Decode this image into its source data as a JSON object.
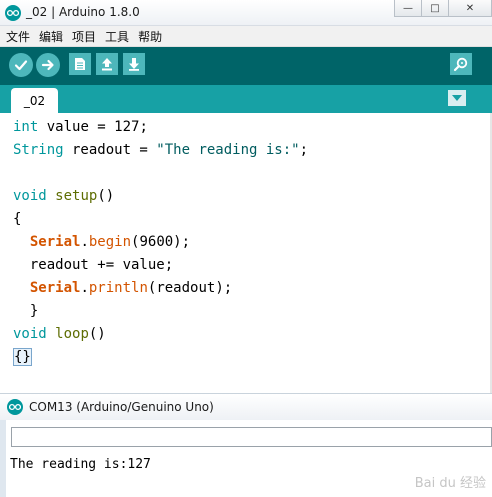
{
  "window": {
    "title": "_02 | Arduino 1.8.0",
    "controls": {
      "minimize": "—",
      "maximize": "□",
      "close": "✕"
    }
  },
  "menu": {
    "items": [
      "文件",
      "编辑",
      "项目",
      "工具",
      "帮助"
    ]
  },
  "toolbar": {
    "buttons": [
      "verify-icon",
      "upload-icon",
      "new-icon",
      "open-icon",
      "save-icon",
      "serial-monitor-icon"
    ]
  },
  "tabs": {
    "active": "_02",
    "menu_icon": "triangle-down-icon"
  },
  "editor": {
    "lines": [
      {
        "type_kw": "int",
        "rest": " value = 127;"
      },
      {
        "type_kw": "String",
        "rest_plain": " readout = ",
        "string": "\"The reading is:\"",
        "end": ";"
      },
      {
        "blank": ""
      },
      {
        "type_kw": "void",
        "func": "setup",
        "rest": "()"
      },
      {
        "text": "{"
      },
      {
        "lib": "Serial",
        "dot": ".",
        "method": "begin",
        "rest": "(9600);"
      },
      {
        "text": "  readout += value;"
      },
      {
        "lib": "Serial",
        "dot": ".",
        "method": "println",
        "rest": "(readout);"
      },
      {
        "text": "  }"
      },
      {
        "type_kw": "void",
        "func": "loop",
        "rest": "()"
      },
      {
        "cursor_text": "{}"
      }
    ],
    "colors": {
      "type": "#00979c",
      "func": "#5e6d03",
      "lib": "#d35400",
      "string": "#005c5f"
    }
  },
  "serial_monitor": {
    "title": "COM13 (Arduino/Genuino Uno)",
    "input_value": "",
    "output": "The reading is:127"
  },
  "watermark": "Bai du 经验"
}
